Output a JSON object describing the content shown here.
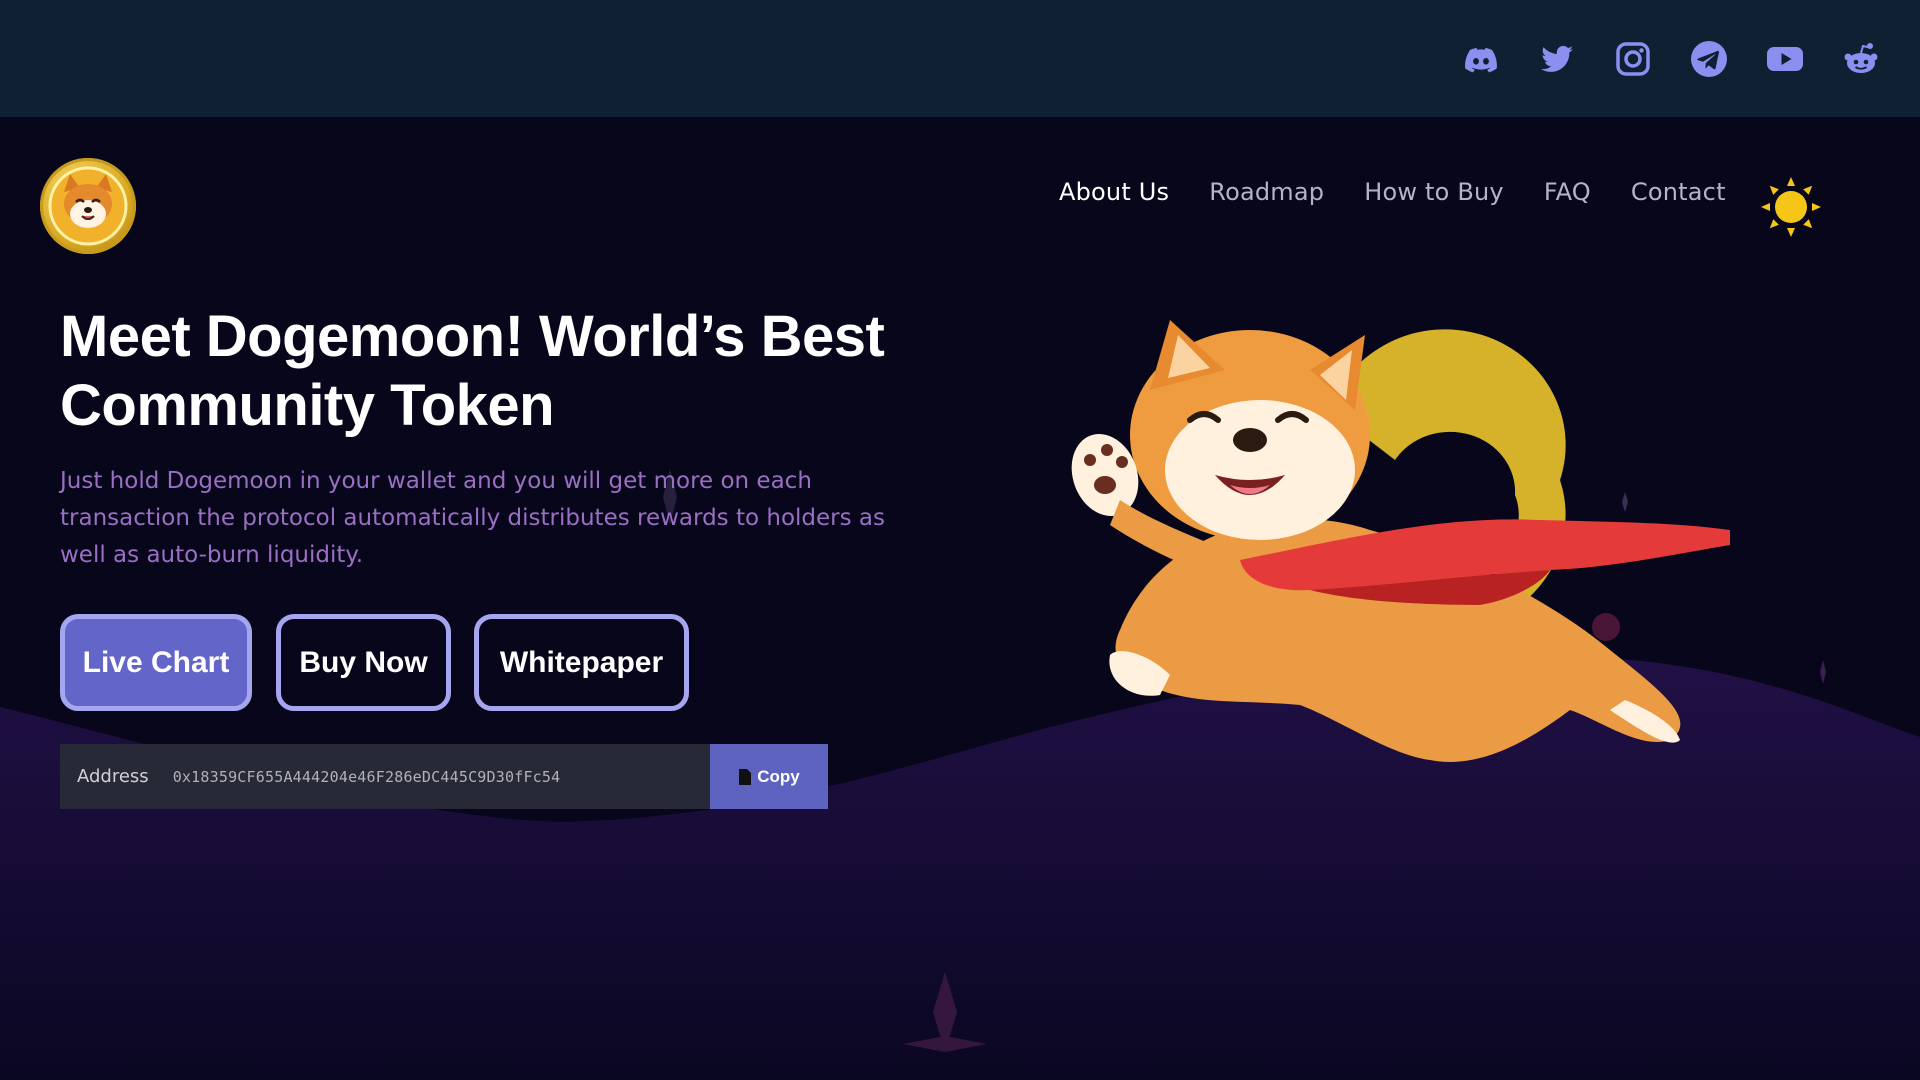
{
  "social": {
    "icons": [
      "discord-icon",
      "twitter-icon",
      "instagram-icon",
      "telegram-icon",
      "youtube-icon",
      "reddit-icon"
    ],
    "icon_color": "#8c8ff0"
  },
  "nav": {
    "items": [
      {
        "label": "About Us",
        "active": true
      },
      {
        "label": "Roadmap",
        "active": false
      },
      {
        "label": "How to Buy",
        "active": false
      },
      {
        "label": "FAQ",
        "active": false
      },
      {
        "label": "Contact",
        "active": false
      }
    ],
    "theme_toggle_icon": "sun-icon"
  },
  "hero": {
    "headline_line1": "Meet Dogemoon! World’s Best",
    "headline_line2": "Community Token",
    "subtext": "Just hold Dogemoon in your wallet and you will get more on each transaction the protocol automatically distributes rewards to holders as well as auto-burn liquidity.",
    "buttons": {
      "live_chart": "Live Chart",
      "buy_now": "Buy Now",
      "whitepaper": "Whitepaper"
    },
    "address": {
      "label": "Address",
      "value": "0x18359CF655A444204e46F286eDC445C9D30fFc54",
      "copy_label": "Copy"
    }
  },
  "colors": {
    "top_bar": "#0e2032",
    "background": "#07061a",
    "accent": "#6366c8",
    "button_border": "#a6a6f0",
    "subtext": "#9a6fc4",
    "sun": "#f5c518"
  }
}
